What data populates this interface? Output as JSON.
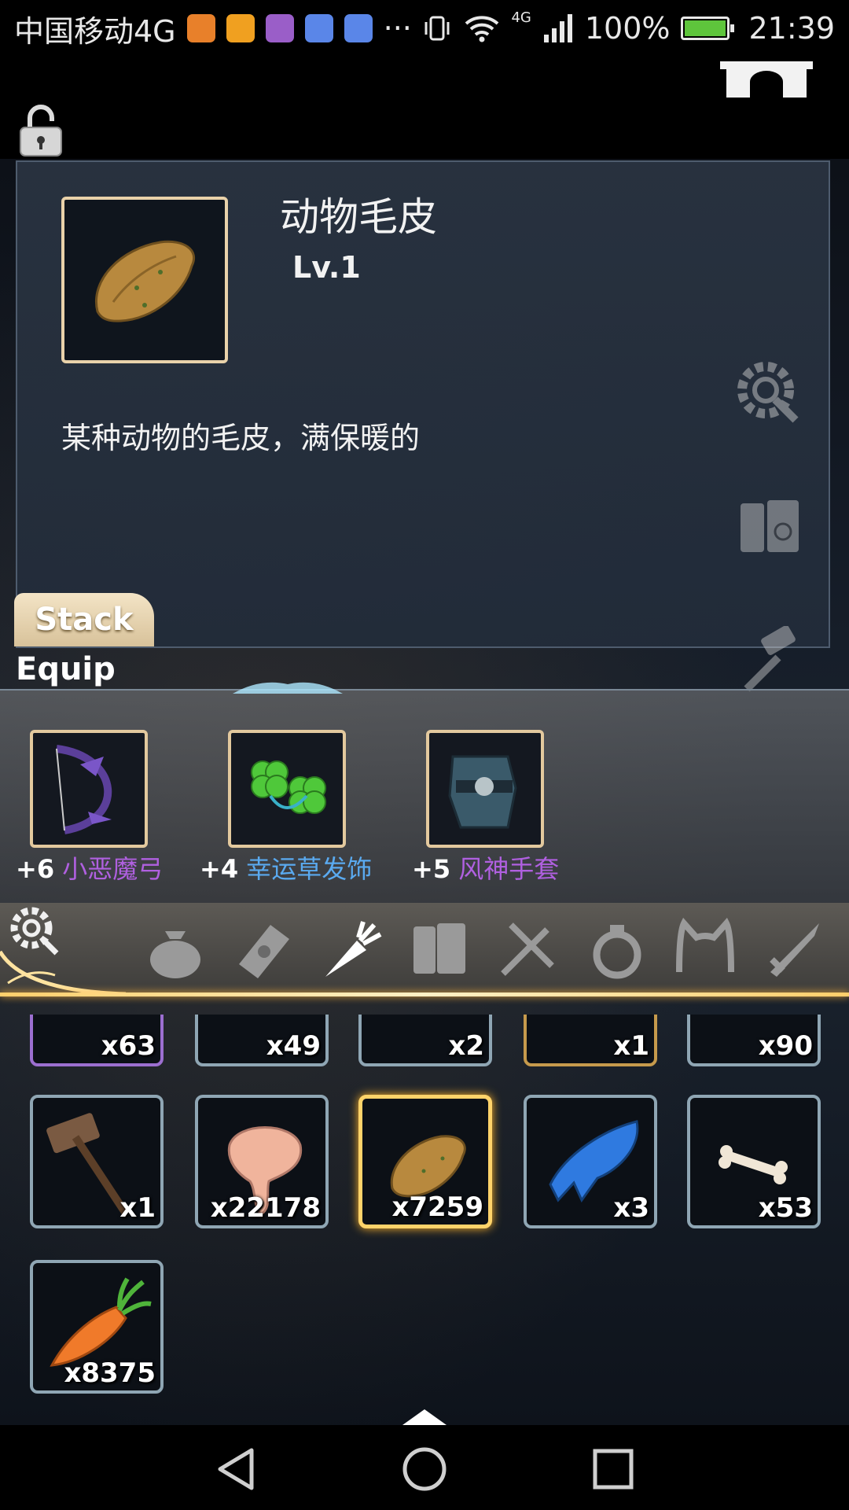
{
  "status_bar": {
    "carrier": "中国移动4G",
    "more": "···",
    "network": "4G",
    "battery_pct": "100%",
    "time": "21:39",
    "notification_colors": [
      "#e8802a",
      "#f0a020",
      "#9a5ec8",
      "#5a86e8",
      "#5a86e8"
    ]
  },
  "detail": {
    "name": "动物毛皮",
    "level": "Lv.1",
    "description": "某种动物的毛皮，满保暖的",
    "stack_tab": "Stack"
  },
  "equip": {
    "label": "Equip",
    "items": [
      {
        "enhance": "+6",
        "name": "小恶魔弓",
        "color": "purple",
        "icon": "bow-icon"
      },
      {
        "enhance": "+4",
        "name": "幸运草发饰",
        "color": "blue",
        "icon": "clover-icon"
      },
      {
        "enhance": "+5",
        "name": "风神手套",
        "color": "purple",
        "icon": "gauntlet-icon"
      }
    ]
  },
  "categories": [
    {
      "icon": "bag-icon"
    },
    {
      "icon": "scroll-icon"
    },
    {
      "icon": "carrot-icon",
      "active": true
    },
    {
      "icon": "book-icon"
    },
    {
      "icon": "fork-knife-icon"
    },
    {
      "icon": "ring-icon"
    },
    {
      "icon": "cat-ears-icon"
    },
    {
      "icon": "sword-icon"
    }
  ],
  "inventory": {
    "row_partial": [
      "x63",
      "x49",
      "x2",
      "x1",
      "x90"
    ],
    "row_full": [
      "x1",
      "x22178",
      "x7259",
      "x3",
      "x53"
    ],
    "row_last": [
      "x8375"
    ]
  }
}
